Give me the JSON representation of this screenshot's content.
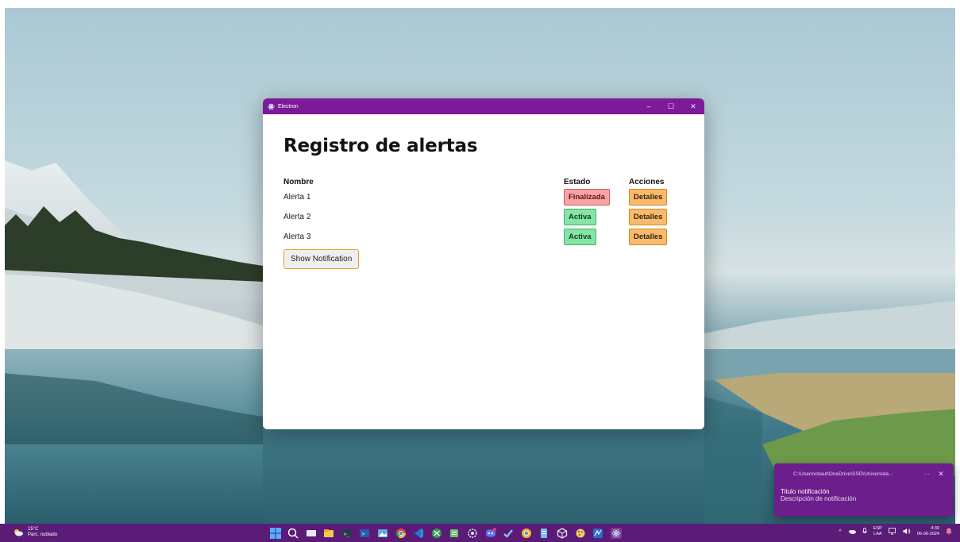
{
  "app": {
    "title_bar": "Electron",
    "page_title": "Registro de alertas",
    "table": {
      "headers": {
        "name": "Nombre",
        "state": "Estado",
        "actions": "Acciones"
      },
      "rows": [
        {
          "name": "Alerta 1",
          "state": "Finalizada",
          "state_kind": "finalizada",
          "action": "Detalles"
        },
        {
          "name": "Alerta 2",
          "state": "Activa",
          "state_kind": "activa",
          "action": "Detalles"
        },
        {
          "name": "Alerta 3",
          "state": "Activa",
          "state_kind": "activa",
          "action": "Detalles"
        }
      ]
    },
    "show_notification_label": "Show Notification",
    "window_controls": {
      "minimize": "–",
      "maximize": "☐",
      "close": "✕"
    }
  },
  "toast": {
    "source_path": "C:\\Users\\cbaut\\OneDrive\\SSD\\Universida...",
    "more": "···",
    "close": "✕",
    "title": "Titulo notificación",
    "description": "Descripción de notificación"
  },
  "taskbar": {
    "weather_temp": "15°C",
    "weather_desc": "Parc. nublado",
    "icons": [
      "start-icon",
      "search-icon",
      "task-view-icon",
      "file-explorer-icon",
      "terminal-icon",
      "powershell-icon",
      "photos-icon",
      "chrome-icon",
      "vscode-icon",
      "xbox-icon",
      "notepad-icon",
      "settings-icon",
      "discord-icon",
      "check-icon",
      "chrome-canary-icon",
      "notes-icon",
      "package-icon",
      "paint-icon",
      "app-icon",
      "electron-icon"
    ],
    "tray": {
      "chevron": "^",
      "lang_top": "ESP",
      "lang_bottom": "LAA",
      "time": "4:30",
      "date": "06-06-2024"
    }
  },
  "colors": {
    "titlebar": "#7e1a9a",
    "taskbar": "#5a1c77",
    "toast": "#6c1e8c",
    "badge_final": "#f6a4a6",
    "badge_active": "#86e4a6",
    "details": "#f8bb6e"
  }
}
